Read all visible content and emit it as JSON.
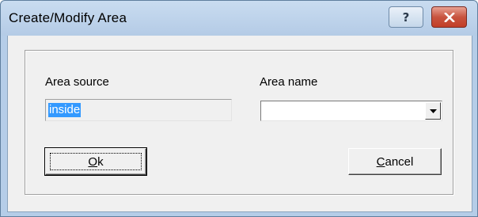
{
  "window": {
    "title": "Create/Modify Area",
    "help_glyph": "?",
    "close_icon": "close-icon",
    "help_icon": "help-icon"
  },
  "form": {
    "area_source_label": "Area source",
    "area_source_value": "inside",
    "area_name_label": "Area name",
    "area_name_value": ""
  },
  "buttons": {
    "ok_mnemonic": "O",
    "ok_rest": "k",
    "cancel_mnemonic": "C",
    "cancel_rest": "ancel"
  },
  "colors": {
    "selection": "#3399ff",
    "close_button": "#c8543f",
    "titlebar": "#b9cfe8",
    "dialog_face": "#f0f0f0"
  }
}
